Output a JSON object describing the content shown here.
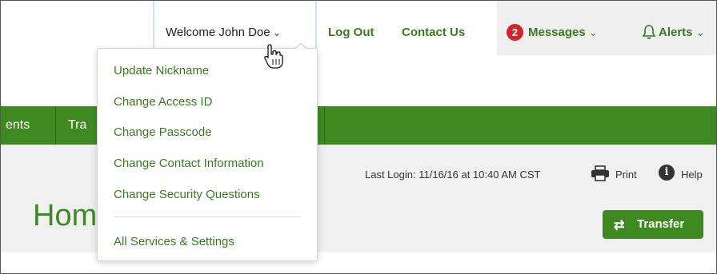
{
  "header": {
    "welcome_label": "Welcome John Doe",
    "logout_label": "Log Out",
    "contact_label": "Contact Us",
    "messages_count": "2",
    "messages_label": "Messages",
    "alerts_label": "Alerts",
    "chevron": "⌄"
  },
  "nav": {
    "items": [
      {
        "label": "ents"
      },
      {
        "label": "Tra"
      }
    ]
  },
  "dropdown": {
    "items": [
      {
        "label": "Update Nickname"
      },
      {
        "label": "Change Access ID"
      },
      {
        "label": "Change Passcode"
      },
      {
        "label": "Change Contact Information"
      },
      {
        "label": "Change Security Questions"
      }
    ],
    "footer_item": "All Services & Settings"
  },
  "content": {
    "last_login": "Last Login: 11/16/16 at 10:40 AM CST",
    "print_label": "Print",
    "help_label": "Help",
    "help_icon_glyph": "i",
    "page_title": "Hom",
    "transfer_label": "Transfer",
    "transfer_icon_glyph": "⇄"
  },
  "colors": {
    "brand_green": "#3e8a21",
    "link_green": "#3a7a1e",
    "badge_red": "#d0242a"
  }
}
